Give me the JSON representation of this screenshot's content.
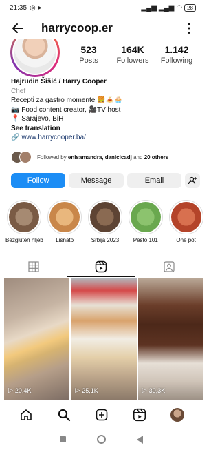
{
  "status": {
    "time": "21:35",
    "battery": "28"
  },
  "header": {
    "username": "harrycoop.er"
  },
  "stats": [
    {
      "value": "523",
      "label": "Posts"
    },
    {
      "value": "164K",
      "label": "Followers"
    },
    {
      "value": "1.142",
      "label": "Following"
    }
  ],
  "bio": {
    "name": "Hajrudin Šišić / Harry Cooper",
    "category": "Chef",
    "line1": "Recepti za gastro momente 🍔🍝🧁",
    "line2": "📷 Food content creator, 🎥TV host",
    "line3": "📍 Sarajevo, BiH",
    "translation": "See translation",
    "link": "www.harrycooper.ba/"
  },
  "followed_by": {
    "prefix": "Followed by ",
    "names": "enisamandra, danicicadj",
    "middle": " and ",
    "others": "20 others"
  },
  "buttons": {
    "follow": "Follow",
    "message": "Message",
    "email": "Email"
  },
  "highlights": [
    {
      "label": "Bezgluten hljeb",
      "color": "#7a5b45"
    },
    {
      "label": "Lisnato",
      "color": "#c9874a"
    },
    {
      "label": "Srbija 2023",
      "color": "#5e4434"
    },
    {
      "label": "Pesto 101",
      "color": "#6aa84f"
    },
    {
      "label": "One pot",
      "color": "#b4442a"
    }
  ],
  "posts": [
    {
      "views": "20,4K"
    },
    {
      "views": "25,1K"
    },
    {
      "views": "30,3K"
    }
  ],
  "colors": {
    "accent": "#1c8df5",
    "link": "#1d3a6e"
  }
}
